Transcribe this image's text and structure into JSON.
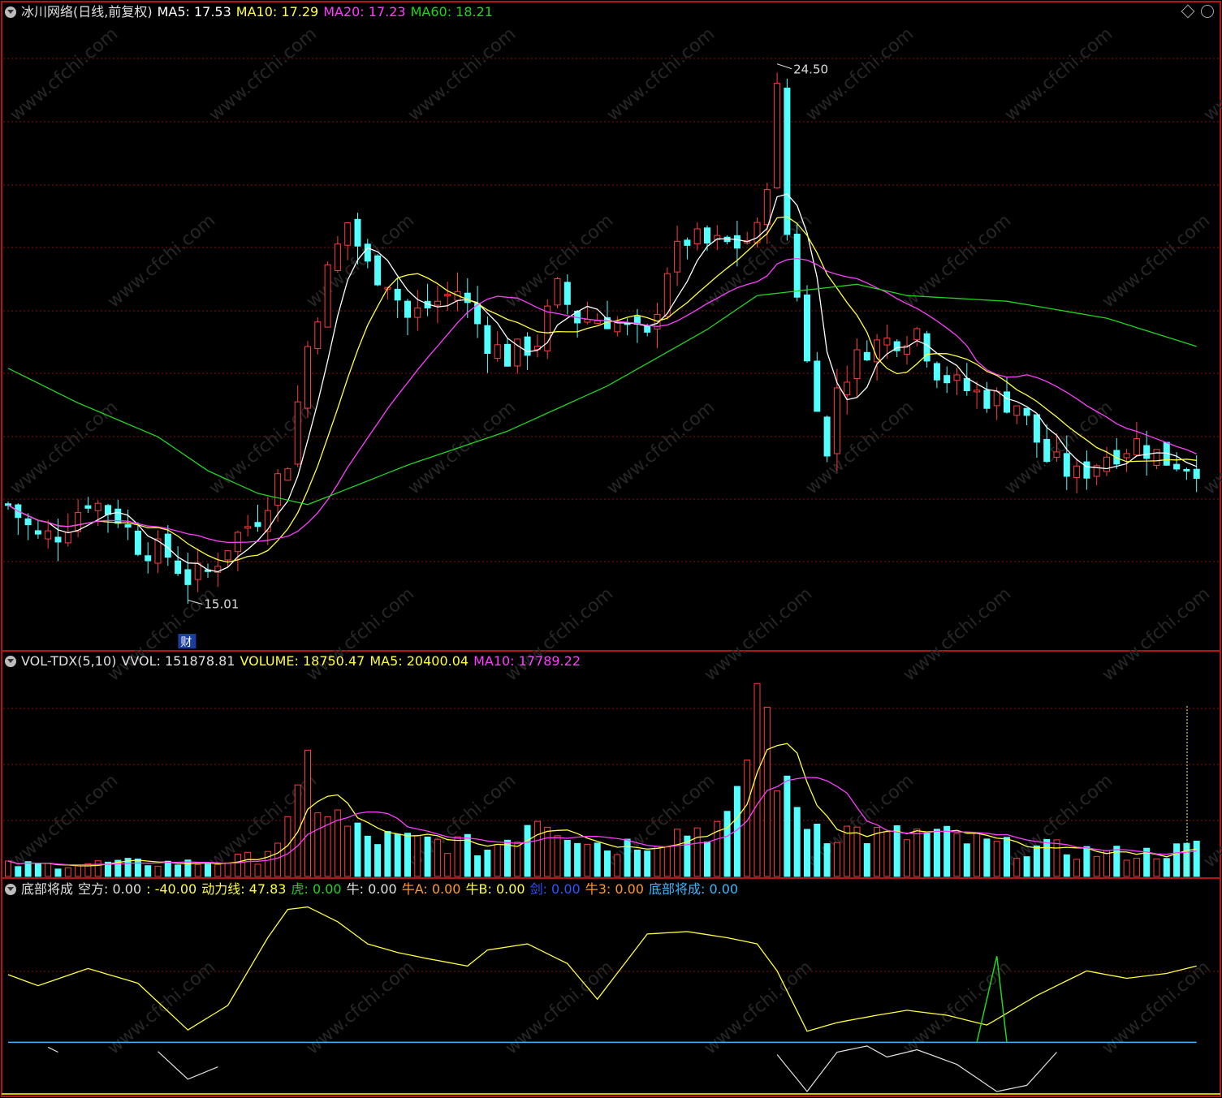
{
  "colors": {
    "up": "#ff3d3d",
    "down": "#54ffff",
    "ma5": "#ffffff",
    "ma10": "#ffff3a",
    "ma20": "#ff3dff",
    "ma60": "#1fd61f",
    "grid": "#8a1010",
    "frame": "#b01616",
    "text": "#e0e0e0",
    "green": "#1fd61f",
    "orange": "#ff9a2a",
    "blue": "#2a55ff",
    "cyan_line": "#3ab7ff"
  },
  "main_header": {
    "title": "冰川网络(日线,前复权)",
    "ma5": "MA5: 17.53",
    "ma10": "MA10: 17.29",
    "ma20": "MA20: 17.23",
    "ma60": "MA60: 18.21",
    "menu_icon": "chevron-down-icon",
    "diamond_icon": "diamond-icon",
    "close_icon": "circle-icon"
  },
  "vol_header": {
    "title": "VOL-TDX(5,10)",
    "vvol": "VVOL: 151878.81",
    "volume": "VOLUME: 18750.47",
    "ma5": "MA5: 20400.04",
    "ma10": "MA10: 17789.22"
  },
  "ind_header": {
    "title": "底部将成",
    "kongfang": "空方: 0.00",
    "neg": ": -40.00",
    "dongli": "动力线: 47.83",
    "hu": "虎: 0.00",
    "niu": "牛: 0.00",
    "niua": "牛A: 0.00",
    "niub": "牛B: 0.00",
    "jian": "剑: 0.00",
    "niu3": "牛3: 0.00",
    "dibu": "底部将成: 0.00"
  },
  "chart_data": [
    {
      "type": "candlestick",
      "name": "price",
      "x_count": 95,
      "ylim": [
        14.5,
        25.2
      ],
      "annotations": {
        "high": "24.50",
        "low": "15.01",
        "event_mark": "财"
      },
      "ohlc_anchors": [
        [
          0,
          16.7
        ],
        [
          3,
          16.1
        ],
        [
          5,
          16.2
        ],
        [
          8,
          16.8
        ],
        [
          11,
          16.5
        ],
        [
          13,
          16.0
        ],
        [
          16,
          15.8
        ],
        [
          18,
          15.4
        ],
        [
          20,
          15.5
        ],
        [
          22,
          16.0
        ],
        [
          25,
          16.5
        ],
        [
          28,
          17.5
        ],
        [
          30,
          19.5
        ],
        [
          32,
          20.8
        ],
        [
          34,
          21.7
        ],
        [
          36,
          20.9
        ],
        [
          38,
          20.7
        ],
        [
          40,
          20.0
        ],
        [
          42,
          20.2
        ],
        [
          45,
          20.5
        ],
        [
          48,
          19.6
        ],
        [
          50,
          19.3
        ],
        [
          53,
          19.6
        ],
        [
          55,
          20.5
        ],
        [
          57,
          20.0
        ],
        [
          60,
          20.0
        ],
        [
          62,
          19.8
        ],
        [
          64,
          19.6
        ],
        [
          66,
          20.9
        ],
        [
          68,
          21.4
        ],
        [
          70,
          21.3
        ],
        [
          73,
          21.3
        ],
        [
          75,
          21.5
        ],
        [
          76,
          22.5
        ],
        [
          77,
          24.0
        ],
        [
          78,
          21.5
        ],
        [
          79,
          20.5
        ],
        [
          80,
          19.2
        ],
        [
          81,
          18.6
        ],
        [
          82,
          17.5
        ],
        [
          83,
          18.8
        ],
        [
          86,
          19.5
        ],
        [
          88,
          19.6
        ],
        [
          91,
          19.8
        ],
        [
          93,
          19.1
        ],
        [
          95,
          18.8
        ],
        [
          98,
          18.6
        ],
        [
          101,
          18.5
        ],
        [
          104,
          17.5
        ],
        [
          107,
          17.2
        ],
        [
          110,
          17.6
        ],
        [
          113,
          17.8
        ],
        [
          116,
          17.5
        ],
        [
          119,
          17.4
        ],
        [
          122,
          17.5
        ],
        [
          124,
          17.4
        ],
        [
          126,
          16.6
        ]
      ],
      "ma60_anchors": [
        [
          -1,
          19.2
        ],
        [
          7,
          18.5
        ],
        [
          15,
          17.9
        ],
        [
          20,
          17.3
        ],
        [
          25,
          16.9
        ],
        [
          30,
          16.7
        ],
        [
          40,
          17.4
        ],
        [
          50,
          18.0
        ],
        [
          60,
          18.8
        ],
        [
          70,
          19.8
        ],
        [
          75,
          20.4
        ],
        [
          80,
          20.5
        ],
        [
          85,
          20.6
        ],
        [
          90,
          20.4
        ],
        [
          100,
          20.3
        ],
        [
          110,
          20.0
        ],
        [
          119,
          19.5
        ]
      ]
    },
    {
      "type": "bar",
      "name": "volume",
      "ylim": [
        0,
        100
      ],
      "peaks": [
        [
          0,
          6
        ],
        [
          5,
          6
        ],
        [
          10,
          7
        ],
        [
          15,
          7
        ],
        [
          20,
          7
        ],
        [
          25,
          10
        ],
        [
          28,
          25
        ],
        [
          29,
          35
        ],
        [
          30,
          55
        ],
        [
          31,
          42
        ],
        [
          32,
          35
        ],
        [
          34,
          25
        ],
        [
          36,
          20
        ],
        [
          40,
          18
        ],
        [
          44,
          18
        ],
        [
          48,
          14
        ],
        [
          51,
          24
        ],
        [
          53,
          35
        ],
        [
          55,
          28
        ],
        [
          58,
          20
        ],
        [
          60,
          15
        ],
        [
          63,
          18
        ],
        [
          66,
          22
        ],
        [
          70,
          26
        ],
        [
          72,
          27
        ],
        [
          73,
          35
        ],
        [
          74,
          65
        ],
        [
          75,
          100
        ],
        [
          76,
          80
        ],
        [
          77,
          60
        ],
        [
          78,
          40
        ],
        [
          80,
          30
        ],
        [
          82,
          25
        ],
        [
          85,
          23
        ],
        [
          88,
          20
        ],
        [
          91,
          22
        ],
        [
          94,
          20
        ],
        [
          100,
          15
        ],
        [
          105,
          14
        ],
        [
          110,
          12
        ],
        [
          114,
          12
        ],
        [
          118,
          14
        ],
        [
          119,
          15
        ]
      ]
    },
    {
      "type": "line",
      "name": "dibu_jiangcheng",
      "ylim": [
        -40,
        115
      ],
      "dongli_anchors": [
        [
          0,
          55
        ],
        [
          3,
          46
        ],
        [
          8,
          60
        ],
        [
          13,
          48
        ],
        [
          18,
          10
        ],
        [
          22,
          30
        ],
        [
          26,
          85
        ],
        [
          28,
          108
        ],
        [
          30,
          110
        ],
        [
          33,
          98
        ],
        [
          36,
          80
        ],
        [
          39,
          73
        ],
        [
          42,
          68
        ],
        [
          46,
          62
        ],
        [
          48,
          75
        ],
        [
          52,
          80
        ],
        [
          56,
          64
        ],
        [
          59,
          35
        ],
        [
          64,
          88
        ],
        [
          68,
          90
        ],
        [
          72,
          85
        ],
        [
          75,
          80
        ],
        [
          77,
          58
        ],
        [
          80,
          9
        ],
        [
          83,
          16
        ],
        [
          87,
          22
        ],
        [
          90,
          26
        ],
        [
          94,
          22
        ],
        [
          98,
          14
        ],
        [
          103,
          38
        ],
        [
          108,
          58
        ],
        [
          112,
          52
        ],
        [
          116,
          56
        ],
        [
          119,
          62
        ]
      ],
      "kong_anchors": [
        [
          3,
          0
        ],
        [
          5,
          -8
        ],
        [
          6,
          0
        ],
        [
          14,
          0
        ],
        [
          18,
          -30
        ],
        [
          21,
          -20
        ],
        [
          22,
          0
        ],
        [
          76,
          0
        ],
        [
          80,
          -40
        ],
        [
          83,
          -8
        ],
        [
          86,
          -3
        ],
        [
          88,
          -12
        ],
        [
          91,
          -6
        ],
        [
          95,
          -18
        ],
        [
          99,
          -40
        ],
        [
          102,
          -35
        ],
        [
          105,
          -8
        ],
        [
          106,
          0
        ]
      ],
      "spike_anchors": [
        [
          97,
          0
        ],
        [
          99,
          70
        ],
        [
          100,
          0
        ]
      ]
    }
  ]
}
